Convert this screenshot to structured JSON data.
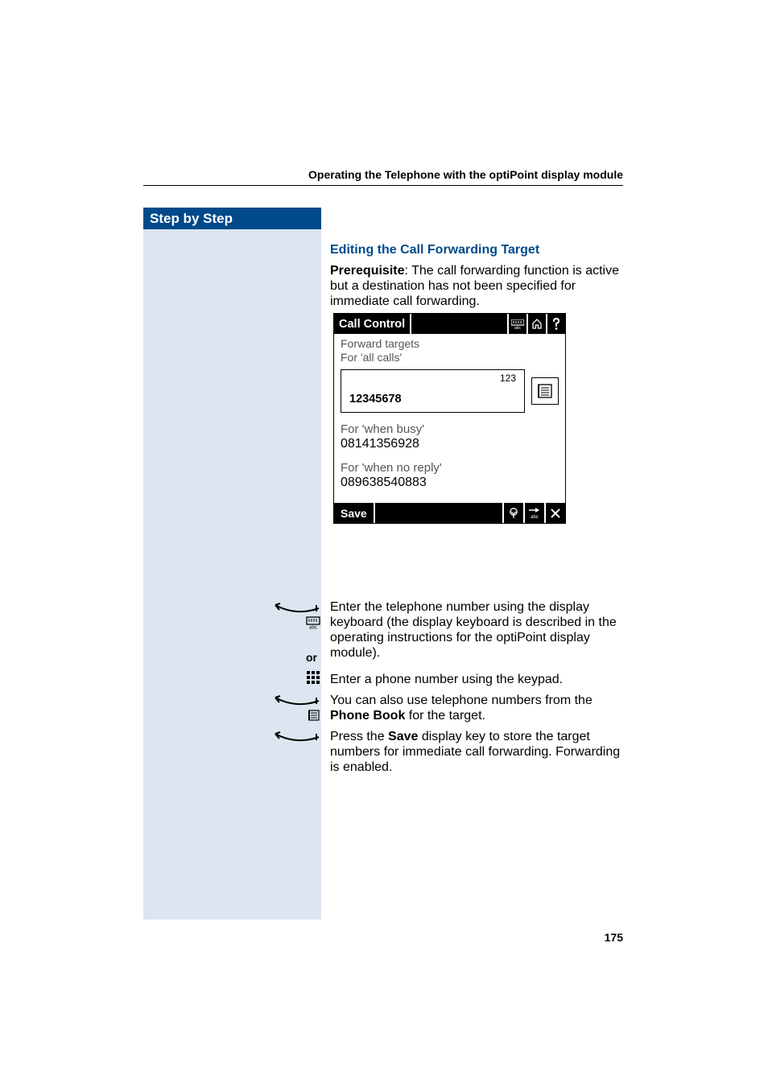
{
  "running_head": "Operating the Telephone with the optiPoint display module",
  "sidebar_title": "Step by Step",
  "heading": "Editing the Call Forwarding Target",
  "prerequisite_label": "Prerequisite",
  "prerequisite_text": ": The call forwarding function is active but a destination has not been specified for immediate call forwarding.",
  "panel": {
    "title": "Call Control",
    "forward_targets": "Forward targets",
    "all_calls_label": "For 'all calls'",
    "input_mode": "123",
    "input_value": "12345678",
    "busy_label": "For 'when busy'",
    "busy_value": "08141356928",
    "noreply_label": "For 'when no reply'",
    "noreply_value": "089638540883",
    "save_label": "Save"
  },
  "or_label": "or",
  "step1": "Enter the telephone number using the display keyboard (the display keyboard is described in the operating instructions for the optiPoint display module).",
  "step2": "Enter a phone number using the keypad.",
  "step3_pre": "You can also use telephone numbers from the ",
  "step3_bold": "Phone Book",
  "step3_post": " for the target.",
  "step4_pre": "Press the ",
  "step4_bold": "Save",
  "step4_post": " display key to store the target numbers for immediate call forwarding. Forwarding is enabled.",
  "page_number": "175"
}
